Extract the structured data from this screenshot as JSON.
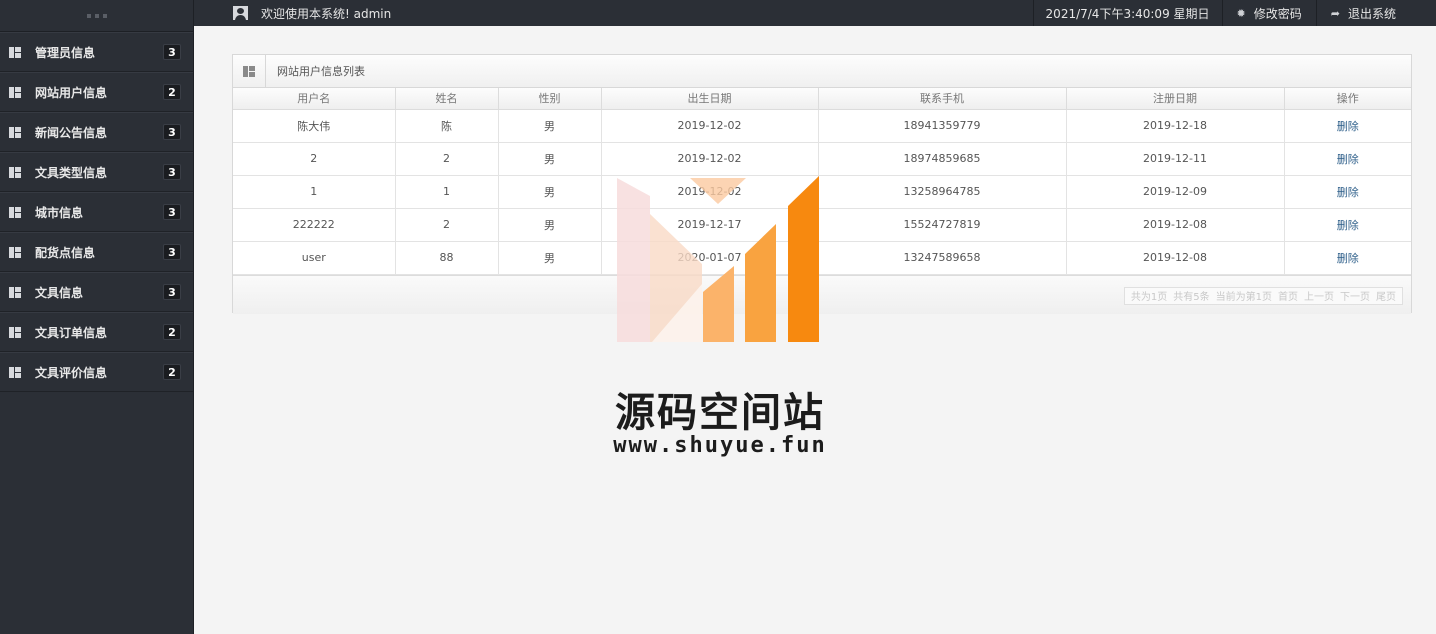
{
  "sidebar": {
    "items": [
      {
        "label": "管理员信息",
        "badge": "3"
      },
      {
        "label": "网站用户信息",
        "badge": "2"
      },
      {
        "label": "新闻公告信息",
        "badge": "3"
      },
      {
        "label": "文具类型信息",
        "badge": "3"
      },
      {
        "label": "城市信息",
        "badge": "3"
      },
      {
        "label": "配货点信息",
        "badge": "3"
      },
      {
        "label": "文具信息",
        "badge": "3"
      },
      {
        "label": "文具订单信息",
        "badge": "2"
      },
      {
        "label": "文具评价信息",
        "badge": "2"
      }
    ]
  },
  "topbar": {
    "welcome": "欢迎使用本系统! admin",
    "datetime": "2021/7/4下午3:40:09 星期日",
    "change_password": "修改密码",
    "logout": "退出系统"
  },
  "panel": {
    "title": "网站用户信息列表",
    "columns": [
      "用户名",
      "姓名",
      "性别",
      "出生日期",
      "联系手机",
      "注册日期",
      "操作"
    ],
    "rows": [
      [
        "陈大伟",
        "陈",
        "男",
        "2019-12-02",
        "18941359779",
        "2019-12-18",
        "删除"
      ],
      [
        "2",
        "2",
        "男",
        "2019-12-02",
        "18974859685",
        "2019-12-11",
        "删除"
      ],
      [
        "1",
        "1",
        "男",
        "2019-12-02",
        "13258964785",
        "2019-12-09",
        "删除"
      ],
      [
        "222222",
        "2",
        "男",
        "2019-12-17",
        "15524727819",
        "2019-12-08",
        "删除"
      ],
      [
        "user",
        "88",
        "男",
        "2020-01-07",
        "13247589658",
        "2019-12-08",
        "删除"
      ]
    ],
    "pager": [
      "共为1页",
      "共有5条",
      "当前为第1页",
      "首页",
      "上一页",
      "下一页",
      "尾页"
    ]
  },
  "watermark": {
    "title": "源码空间站",
    "url": "www.shuyue.fun"
  },
  "colors": {
    "sidebar_bg": "#2b2f36",
    "content_bg": "#f4f4f4",
    "link": "#2e5f8a",
    "watermark_orange": "#f7890f"
  }
}
